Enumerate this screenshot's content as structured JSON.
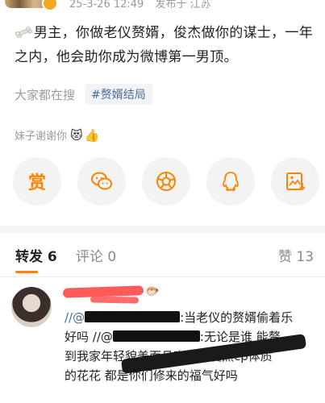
{
  "post": {
    "meta": {
      "date": "25-3-26 12:49",
      "location": "发布于 江苏"
    },
    "text": "男主，你做老仪赘婿，俊杰做你的谋士，一年之内，他会助你成为微博第一男顶。",
    "hot_label": "大家都在搜",
    "hot_tag": "#赘婿结局",
    "thanks_text": "妹子谢谢你"
  },
  "share_buttons": [
    {
      "name": "reward-button",
      "icon": "reward-icon",
      "label": "赏",
      "color": "#ff8200"
    },
    {
      "name": "wechat-share-button",
      "icon": "wechat-icon",
      "color": "#ff8200"
    },
    {
      "name": "moments-share-button",
      "icon": "moments-icon",
      "color": "#ff8200"
    },
    {
      "name": "qq-share-button",
      "icon": "qq-icon",
      "color": "#ff8200"
    },
    {
      "name": "save-image-button",
      "icon": "save-image-icon",
      "color": "#ff8200"
    }
  ],
  "tabs": {
    "repost": "转发 6",
    "comment": "评论 0",
    "like": "赞 13"
  },
  "comment": {
    "line1_prefix": "//@",
    "line1_suffix": ":当老仪的赘婿偷着乐",
    "line2_prefix": "好吗 //@",
    "line2_suffix": ":无论是谁 能赘",
    "line3": "到我家年轻貌美而且高话题度热cp体质",
    "line4": "的花花 都是你们修来的福气好吗"
  },
  "colors": {
    "accent": "#ff8200",
    "link": "#4a6d9c"
  }
}
